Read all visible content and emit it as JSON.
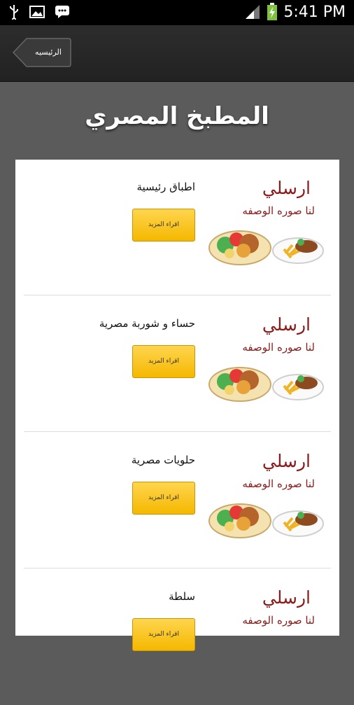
{
  "status_bar": {
    "time": "5:41 PM"
  },
  "action_bar": {
    "back_label": "الرئيسيه"
  },
  "page": {
    "title": "المطبخ المصري"
  },
  "categories": [
    {
      "title": "اطباق رئيسية",
      "button": "اقراء المزيد",
      "promo_line1": "ارسلي",
      "promo_line2": "لنا صوره الوصفه"
    },
    {
      "title": "حساء و شوربة مصرية",
      "button": "اقراء المزيد",
      "promo_line1": "ارسلي",
      "promo_line2": "لنا صوره الوصفه"
    },
    {
      "title": "حلويات مصرية",
      "button": "اقراء المزيد",
      "promo_line1": "ارسلي",
      "promo_line2": "لنا صوره الوصفه"
    },
    {
      "title": "سلطة",
      "button": "اقراء المزيد",
      "promo_line1": "ارسلي",
      "promo_line2": "لنا صوره الوصفه"
    }
  ],
  "colors": {
    "accent": "#f5b800",
    "promo_text": "#8b1a1a",
    "background": "#5b5b5b"
  }
}
